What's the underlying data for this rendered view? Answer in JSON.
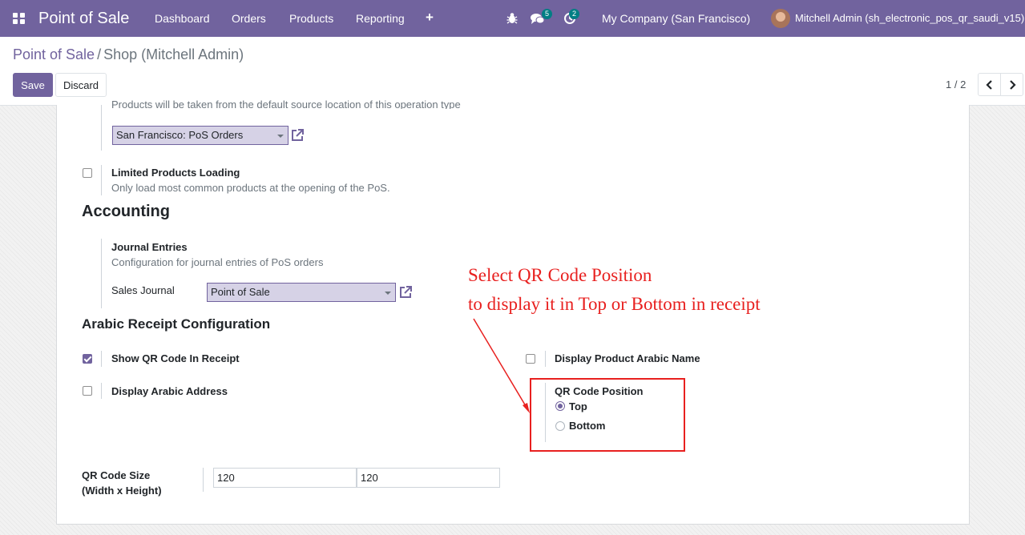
{
  "navbar": {
    "app_name": "Point of Sale",
    "menu": [
      "Dashboard",
      "Orders",
      "Products",
      "Reporting"
    ],
    "add_icon": "plus-icon",
    "bug_icon": "bug-icon",
    "messages_icon": "chat-icon",
    "messages_count": "5",
    "activity_icon": "clock-icon",
    "activity_count": "2",
    "company": "My Company (San Francisco)",
    "user": "Mitchell Admin (sh_electronic_pos_qr_saudi_v15)"
  },
  "control_panel": {
    "breadcrumb_parent": "Point of Sale",
    "breadcrumb_separator": "/",
    "breadcrumb_current": "Shop (Mitchell Admin)",
    "save_label": "Save",
    "discard_label": "Discard",
    "pager": "1 / 2"
  },
  "form": {
    "operation_type_help": "Products will be taken from the default source location of this operation type",
    "operation_type_value": "San Francisco: PoS Orders",
    "limited_products": {
      "label": "Limited Products Loading",
      "help": "Only load most common products at the opening of the PoS.",
      "checked": false
    },
    "accounting_title": "Accounting",
    "journal_entries": {
      "label": "Journal Entries",
      "help": "Configuration for journal entries of PoS orders",
      "sales_journal_label": "Sales Journal",
      "sales_journal_value": "Point of Sale"
    },
    "arabic_title": "Arabic Receipt Configuration",
    "show_qr": {
      "label": "Show QR Code In Receipt",
      "checked": true
    },
    "display_arabic_address": {
      "label": "Display Arabic Address",
      "checked": false
    },
    "display_arabic_name": {
      "label": "Display Product Arabic Name",
      "checked": false
    },
    "qr_position": {
      "label": "QR Code Position",
      "options": [
        "Top",
        "Bottom"
      ],
      "selected": "Top"
    },
    "qr_size": {
      "label_line1": "QR Code Size",
      "label_line2": "(Width x Height)",
      "width": "120",
      "height": "120"
    }
  },
  "annotation": {
    "line1": "Select QR Code Position",
    "line2": "to display it in Top or Bottom in receipt",
    "color": "#e8201f"
  },
  "colors": {
    "brand": "#71639e",
    "badge": "#017e84"
  }
}
